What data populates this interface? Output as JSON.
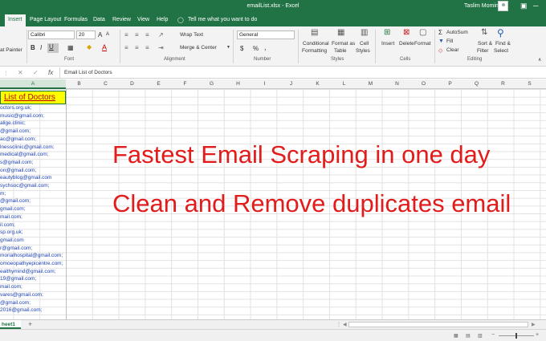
{
  "title": "emailList.xlsx  -  Excel",
  "user": {
    "name": "Taslim Momin"
  },
  "menu": {
    "tabs": [
      "Insert",
      "Page Layout",
      "Formulas",
      "Data",
      "Review",
      "View",
      "Help"
    ],
    "tell": "Tell me what you want to do"
  },
  "ribbon": {
    "clipboard": {
      "painter": "at Painter"
    },
    "font": {
      "name": "Calibri",
      "size": "20",
      "bold": "B",
      "italic": "I",
      "underline": "U",
      "group": "Font"
    },
    "alignment": {
      "wrap": "Wrap Text",
      "merge": "Merge & Center",
      "group": "Alignment"
    },
    "number": {
      "format": "General",
      "currency": "$",
      "percent": "%",
      "comma": ",",
      "group": "Number"
    },
    "styles": {
      "conditional": "Conditional",
      "formatting": "Formatting",
      "format_as": "Format as",
      "table": "Table",
      "cell": "Cell",
      "cell_styles": "Styles",
      "group": "Styles"
    },
    "cells": {
      "insert": "Insert",
      "delete": "Delete",
      "format": "Format",
      "group": "Cells"
    },
    "editing": {
      "autosum": "AutoSum",
      "fill": "Fill",
      "clear": "Clear",
      "sort": "Sort &",
      "filter": "Filter",
      "find": "Find &",
      "select": "Select",
      "group": "Editing"
    }
  },
  "formula": {
    "fx": "fx",
    "value": "Email List of Doctors"
  },
  "columns": [
    "A",
    "B",
    "C",
    "D",
    "E",
    "F",
    "G",
    "H",
    "I",
    "J",
    "K",
    "L",
    "M",
    "N",
    "O",
    "P",
    "Q",
    "R",
    "S"
  ],
  "a1": "List of Doctors",
  "rows": [
    "octors.org.uk;",
    "music@gmail.com;",
    "alige.clinic;",
    "@gmail.com;",
    "ac@gmail.com;",
    "lnessclinic@gmail.com;",
    "medical@gmail.com;",
    "s@gmail.com;",
    "on@gmail.com;",
    "eautyblog@gmail.com",
    "sychsoc@gmail.com;",
    "m;",
    "@gmail.com;",
    "gmail.com;",
    "mail.com;",
    "il.com;",
    "sp.org.uk;",
    "gmail.com",
    "r@gmail.com;",
    "morialhospital@gmail.com;",
    "omoeopathyepicentre.com;",
    "ealthymind@gmail.com;",
    "19@gmail.com;",
    "mail.com;",
    "vares@gmail.com;",
    "@gmail.com;",
    "2016@gmail.com;"
  ],
  "overlay": {
    "line1": "Fastest Email Scraping in one day",
    "line2": "Clean and Remove duplicates email"
  },
  "sheet": {
    "name": "heet1",
    "add": "+"
  }
}
